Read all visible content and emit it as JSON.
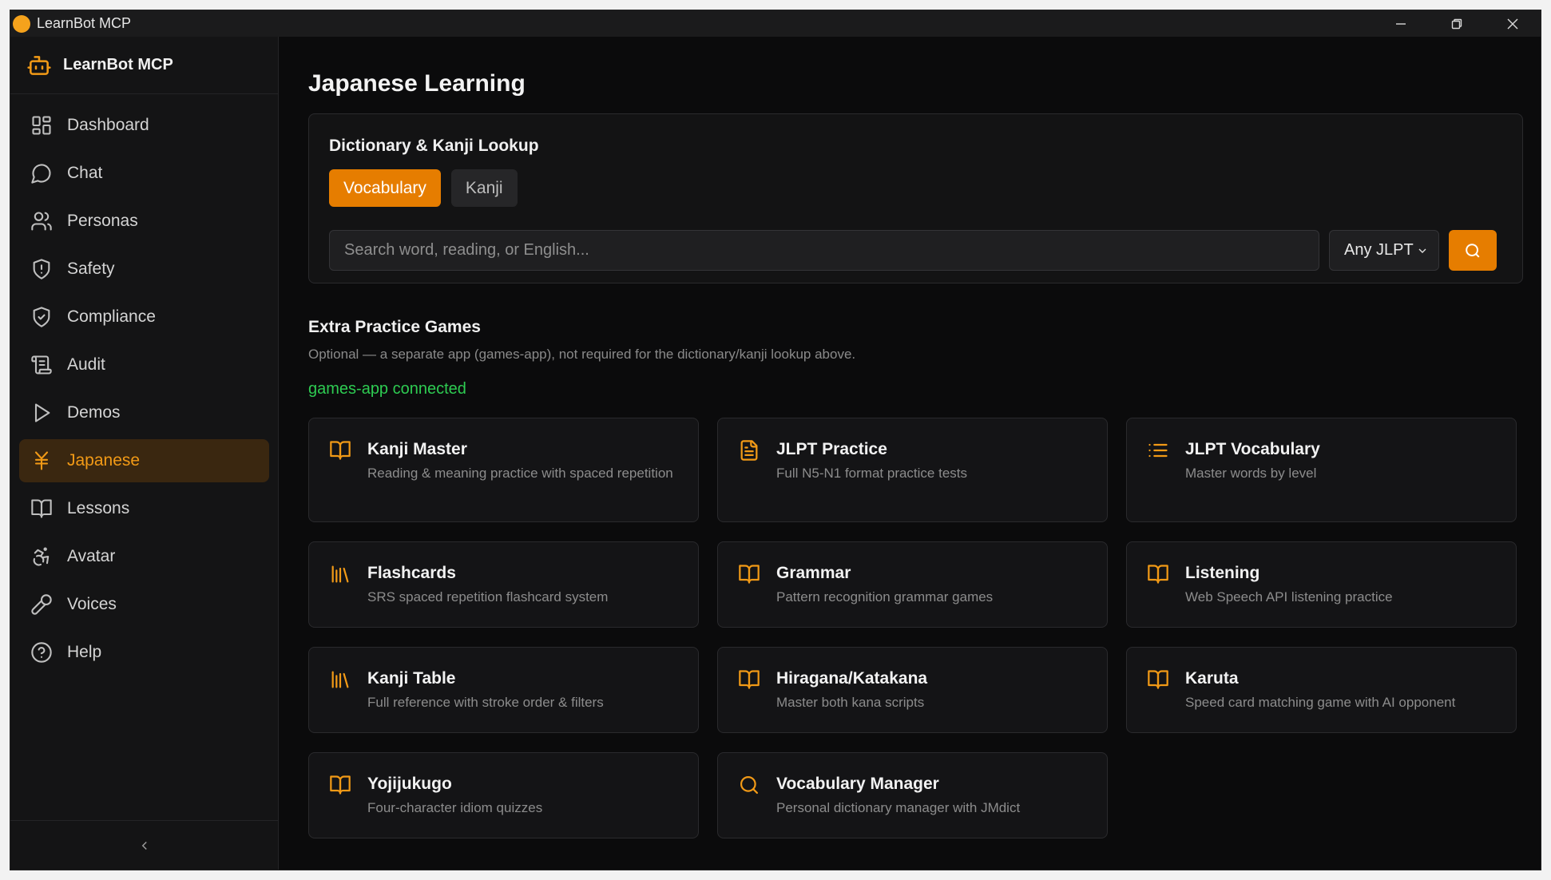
{
  "window": {
    "title": "LearnBot MCP"
  },
  "sidebar": {
    "brand": "LearnBot MCP",
    "items": [
      {
        "label": "Dashboard",
        "icon": "dashboard-icon",
        "active": false
      },
      {
        "label": "Chat",
        "icon": "chat-icon",
        "active": false
      },
      {
        "label": "Personas",
        "icon": "users-icon",
        "active": false
      },
      {
        "label": "Safety",
        "icon": "shield-alert-icon",
        "active": false
      },
      {
        "label": "Compliance",
        "icon": "shield-check-icon",
        "active": false
      },
      {
        "label": "Audit",
        "icon": "scroll-icon",
        "active": false
      },
      {
        "label": "Demos",
        "icon": "play-icon",
        "active": false
      },
      {
        "label": "Japanese",
        "icon": "yen-icon",
        "active": true
      },
      {
        "label": "Lessons",
        "icon": "book-icon",
        "active": false
      },
      {
        "label": "Avatar",
        "icon": "accessibility-icon",
        "active": false
      },
      {
        "label": "Voices",
        "icon": "microphone-icon",
        "active": false
      },
      {
        "label": "Help",
        "icon": "help-icon",
        "active": false
      }
    ],
    "collapse_icon": "chevron-left-icon"
  },
  "main": {
    "page_title": "Japanese Learning",
    "lookup": {
      "heading": "Dictionary & Kanji Lookup",
      "tabs": [
        {
          "label": "Vocabulary",
          "active": true
        },
        {
          "label": "Kanji",
          "active": false
        }
      ],
      "search_placeholder": "Search word, reading, or English...",
      "search_value": "",
      "jlpt_selected": "Any JLPT"
    },
    "games": {
      "title": "Extra Practice Games",
      "subtitle": "Optional — a separate app (games-app), not required for the dictionary/kanji lookup above.",
      "status": "games-app connected",
      "cards": [
        {
          "title": "Kanji Master",
          "desc": "Reading & meaning practice with spaced repetition",
          "icon": "book-open-icon"
        },
        {
          "title": "JLPT Practice",
          "desc": "Full N5-N1 format practice tests",
          "icon": "file-text-icon"
        },
        {
          "title": "JLPT Vocabulary",
          "desc": "Master words by level",
          "icon": "list-icon"
        },
        {
          "title": "Flashcards",
          "desc": "SRS spaced repetition flashcard system",
          "icon": "library-icon"
        },
        {
          "title": "Grammar",
          "desc": "Pattern recognition grammar games",
          "icon": "book-open-icon"
        },
        {
          "title": "Listening",
          "desc": "Web Speech API listening practice",
          "icon": "book-open-icon"
        },
        {
          "title": "Kanji Table",
          "desc": "Full reference with stroke order & filters",
          "icon": "library-icon"
        },
        {
          "title": "Hiragana/Katakana",
          "desc": "Master both kana scripts",
          "icon": "book-open-icon"
        },
        {
          "title": "Karuta",
          "desc": "Speed card matching game with AI opponent",
          "icon": "book-open-icon"
        },
        {
          "title": "Yojijukugo",
          "desc": "Four-character idiom quizzes",
          "icon": "book-open-icon"
        },
        {
          "title": "Vocabulary Manager",
          "desc": "Personal dictionary manager with JMdict",
          "icon": "search-icon"
        }
      ]
    }
  },
  "colors": {
    "accent": "#e67d00",
    "accent_text": "#f29a16",
    "status_green": "#2ecc52",
    "background": "#0b0b0c"
  }
}
